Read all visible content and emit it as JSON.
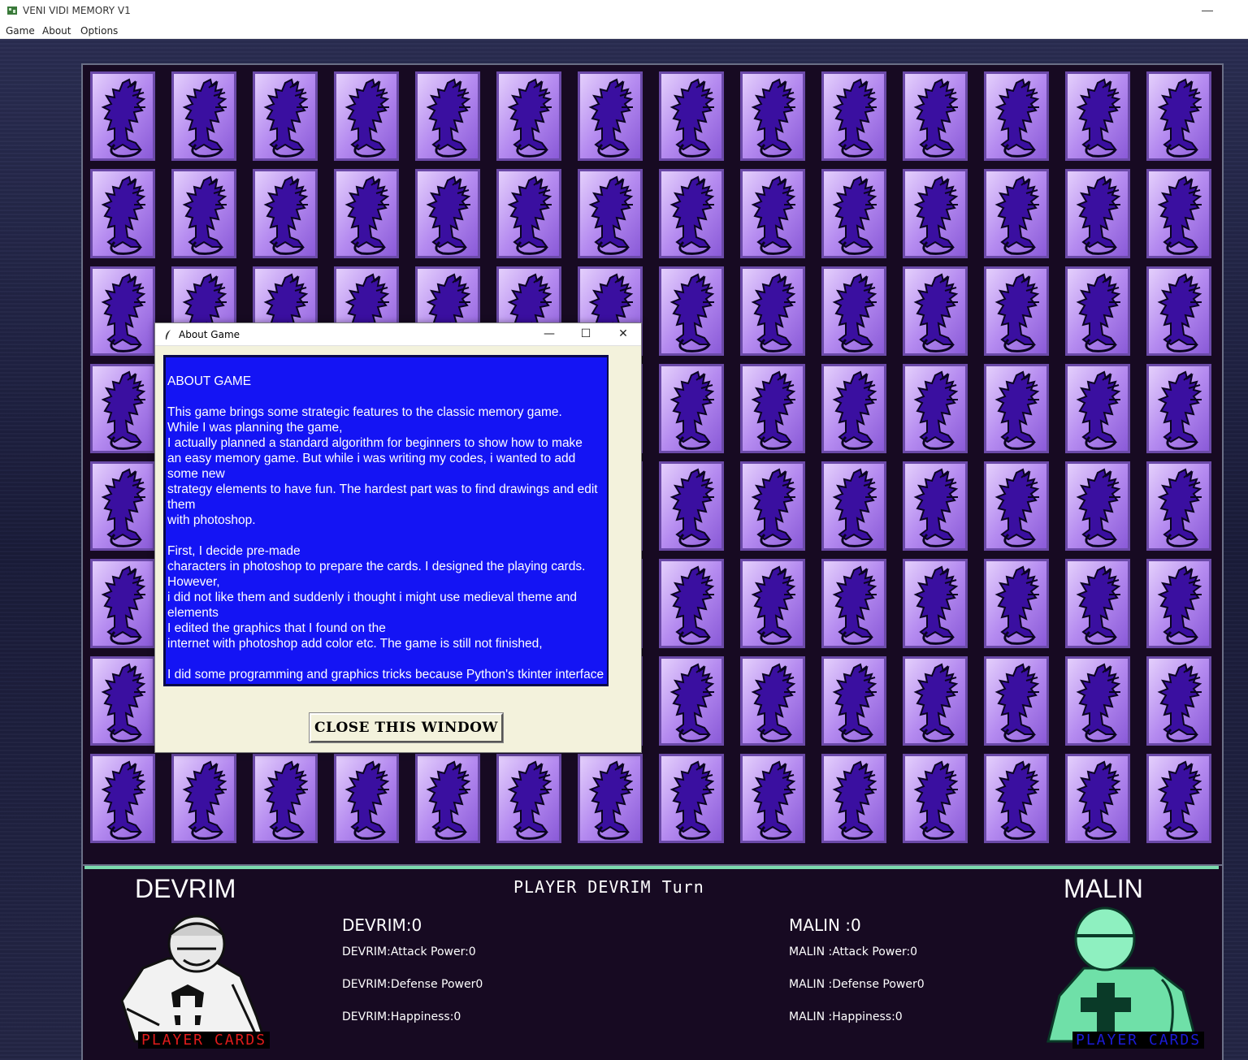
{
  "window": {
    "title": "VENI VIDI MEMORY V1",
    "minimize_glyph": "—"
  },
  "menu": [
    {
      "label": "Game"
    },
    {
      "label": "About"
    },
    {
      "label": "Options"
    }
  ],
  "board": {
    "rows": 8,
    "cols": 14,
    "card_icon": "dragon-card-back-icon",
    "colors": {
      "card": "#b58bf0",
      "dragon": "#3a0fa0",
      "board_bg": "#170a22"
    }
  },
  "players": {
    "left": {
      "name": "DEVRIM",
      "score_label": "DEVRIM:0",
      "attack": "DEVRIM:Attack Power:0",
      "defense": "DEVRIM:Defense Power0",
      "happiness": "DEVRIM:Happiness:0",
      "cards_label": "PLAYER CARDS",
      "cards_color": "#e01b1b",
      "portrait_icon": "knight-white-icon"
    },
    "right": {
      "name": "MALIN",
      "score_label": "MALIN :0",
      "attack": "MALIN :Attack Power:0",
      "defense": "MALIN :Defense Power0",
      "happiness": "MALIN :Happiness:0",
      "cards_label": "PLAYER CARDS",
      "cards_color": "#1b1bd6",
      "portrait_icon": "knight-green-icon"
    }
  },
  "turn_text": "PLAYER DEVRIM Turn",
  "dialog": {
    "title": "About Game",
    "minimize": "—",
    "maximize": "☐",
    "close": "✕",
    "body": "ABOUT GAME\n\nThis game brings some strategic features to the classic memory game.\nWhile I was planning the game,\nI actually planned a standard algorithm for beginners to show how to make\nan easy memory game. But while i was writing my codes, i wanted to add\nsome new\nstrategy elements to have fun. The hardest part was to find drawings and edit\nthem\nwith photoshop.\n\nFirst, I decide pre-made\ncharacters in photoshop to prepare the cards. I designed the playing cards.\nHowever,\ni did not like them and suddenly i thought i might use medieval theme and\nelements\nI edited the graphics that I found on the\ninternet with photoshop add color etc. The game is still not finished,\n\nI did some programming and graphics tricks because Python's tkinter interface",
    "close_button": "CLOSE THIS WINDOW",
    "text_bg": "#1414f4"
  }
}
